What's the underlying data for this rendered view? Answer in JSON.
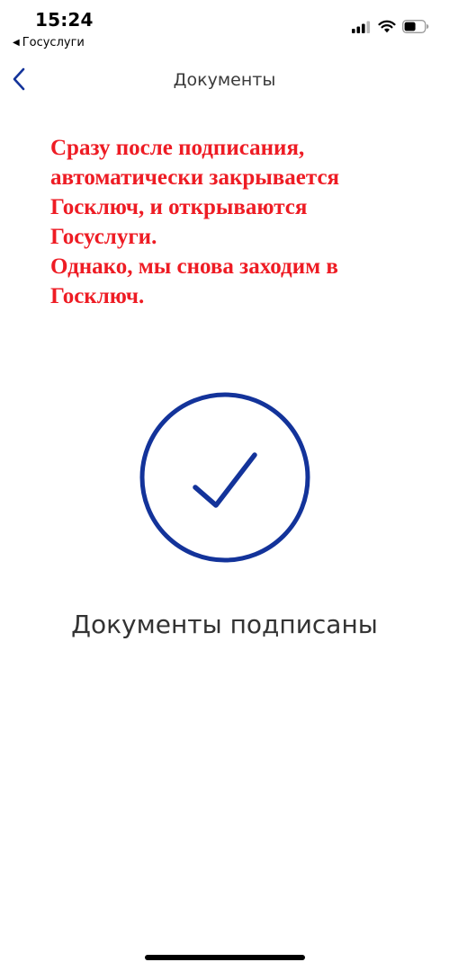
{
  "status_bar": {
    "time": "15:24",
    "back_app": "Госуслуги",
    "back_glyph": "◀"
  },
  "nav": {
    "title": "Документы",
    "back_icon": "chevron-left-icon"
  },
  "annotation": {
    "lines": [
      "Сразу после подписания,",
      "автоматически закрывается",
      "Госключ, и открываются",
      "Госуслуги.",
      "Однако, мы снова заходим в",
      "Госключ."
    ]
  },
  "main": {
    "status_text": "Документы подписаны",
    "status_icon": "check-circle-icon"
  },
  "colors": {
    "accent": "#13339a",
    "annotation": "#ee1c24",
    "text": "#333333"
  }
}
